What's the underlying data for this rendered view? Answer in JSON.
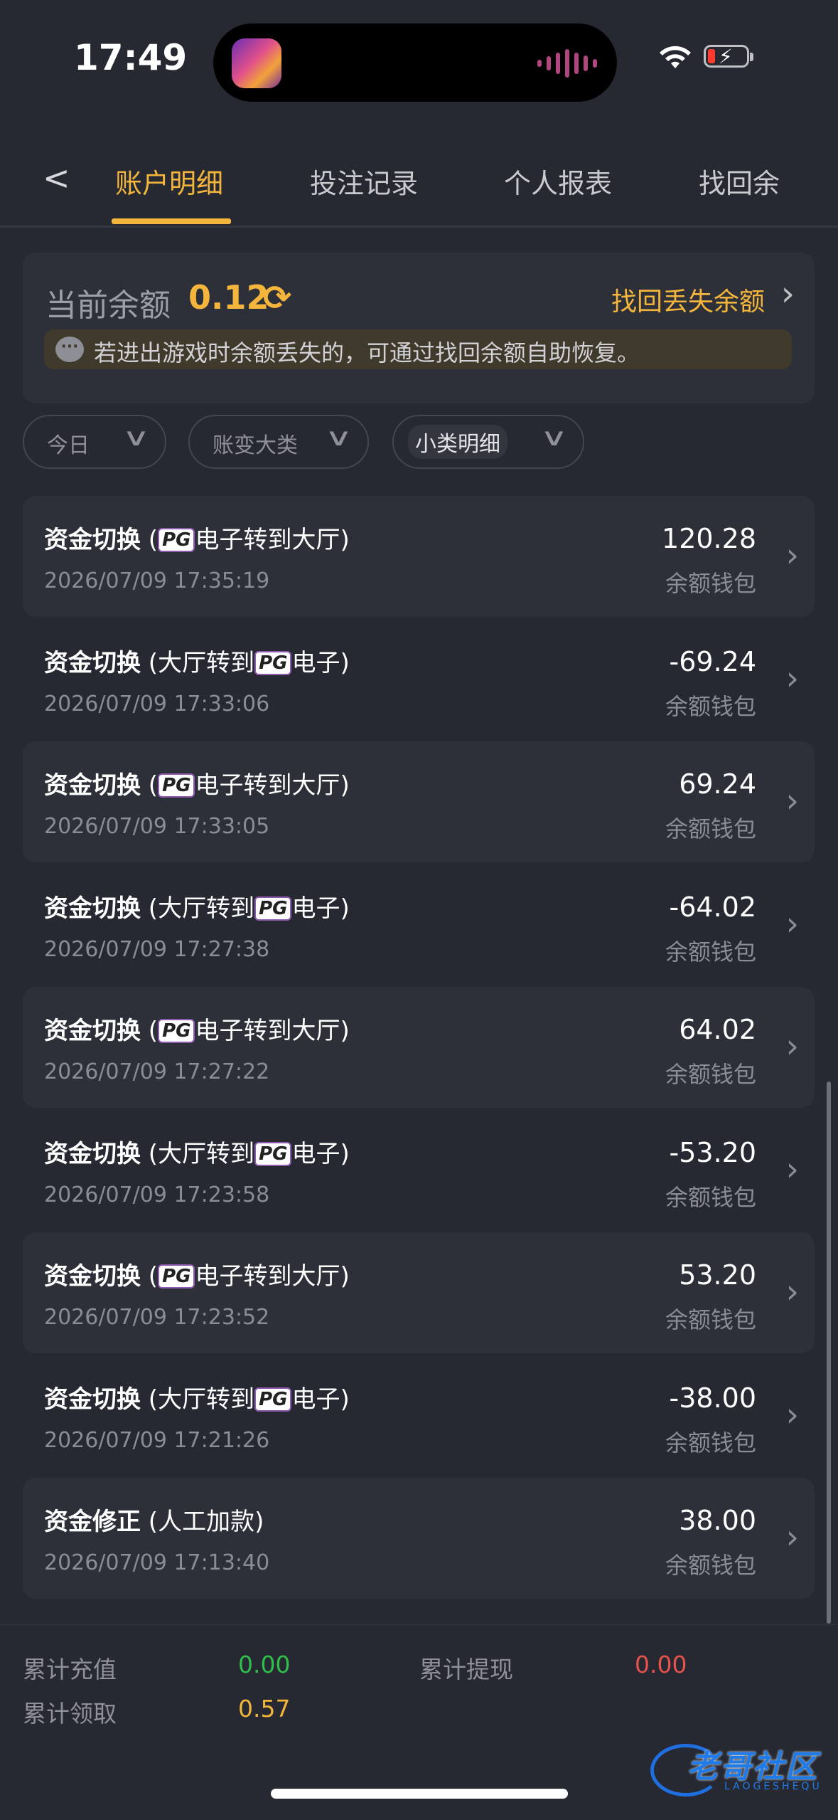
{
  "status_bar": {
    "time": "17:49",
    "icons": [
      "wifi-icon",
      "battery-low-charging-icon"
    ]
  },
  "tabs": {
    "back_icon": "chevron-left-icon",
    "items": [
      {
        "label": "账户明细",
        "active": true
      },
      {
        "label": "投注记录",
        "active": false
      },
      {
        "label": "个人报表",
        "active": false
      },
      {
        "label": "找回余",
        "active": false
      }
    ]
  },
  "balance": {
    "label": "当前余额",
    "value": "0.12",
    "refresh_icon": "refresh-icon",
    "recover_label": "找回丢失余额",
    "notice_icon": "chat-bubble-icon",
    "notice_text": "若进出游戏时余额丢失的，可通过找回余额自助恢复。"
  },
  "filters": [
    {
      "label": "今日",
      "selected": false
    },
    {
      "label": "账变大类",
      "selected": false
    },
    {
      "label": "小类明细",
      "selected": true
    }
  ],
  "transactions": [
    {
      "type": "资金切换",
      "detail_pre": " (",
      "pg": "PG",
      "detail_post": "电子转到大厅)",
      "date": "2026/07/09 17:35:19",
      "amount": "120.28",
      "wallet": "余额钱包"
    },
    {
      "type": "资金切换",
      "detail_pre": " (大厅转到",
      "pg": "PG",
      "detail_post": "电子)",
      "date": "2026/07/09 17:33:06",
      "amount": "-69.24",
      "wallet": "余额钱包"
    },
    {
      "type": "资金切换",
      "detail_pre": " (",
      "pg": "PG",
      "detail_post": "电子转到大厅)",
      "date": "2026/07/09 17:33:05",
      "amount": "69.24",
      "wallet": "余额钱包"
    },
    {
      "type": "资金切换",
      "detail_pre": " (大厅转到",
      "pg": "PG",
      "detail_post": "电子)",
      "date": "2026/07/09 17:27:38",
      "amount": "-64.02",
      "wallet": "余额钱包"
    },
    {
      "type": "资金切换",
      "detail_pre": " (",
      "pg": "PG",
      "detail_post": "电子转到大厅)",
      "date": "2026/07/09 17:27:22",
      "amount": "64.02",
      "wallet": "余额钱包"
    },
    {
      "type": "资金切换",
      "detail_pre": " (大厅转到",
      "pg": "PG",
      "detail_post": "电子)",
      "date": "2026/07/09 17:23:58",
      "amount": "-53.20",
      "wallet": "余额钱包"
    },
    {
      "type": "资金切换",
      "detail_pre": " (",
      "pg": "PG",
      "detail_post": "电子转到大厅)",
      "date": "2026/07/09 17:23:52",
      "amount": "53.20",
      "wallet": "余额钱包"
    },
    {
      "type": "资金切换",
      "detail_pre": " (大厅转到",
      "pg": "PG",
      "detail_post": "电子)",
      "date": "2026/07/09 17:21:26",
      "amount": "-38.00",
      "wallet": "余额钱包"
    },
    {
      "type": "资金修正",
      "detail_pre": " (人工加款)",
      "pg": "",
      "detail_post": "",
      "date": "2026/07/09 17:13:40",
      "amount": "38.00",
      "wallet": "余额钱包"
    }
  ],
  "summary": {
    "recharge_label": "累计充值",
    "recharge_value": "0.00",
    "recharge_color": "#2fbf4a",
    "withdraw_label": "累计提现",
    "withdraw_value": "0.00",
    "withdraw_color": "#e5534b",
    "claim_label": "累计领取",
    "claim_value": "0.57",
    "claim_color": "#f3b53b"
  },
  "watermark": {
    "text": "老哥社区",
    "subtext": "LAOGESHEQU"
  },
  "colors": {
    "accent": "#f3b53b",
    "background": "#262832",
    "card": "#2e3039"
  }
}
